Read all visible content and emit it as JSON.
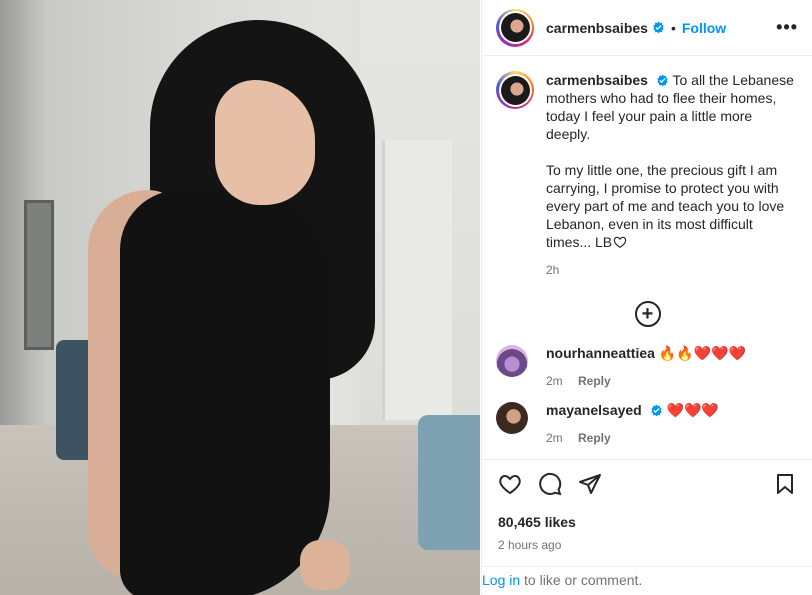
{
  "post": {
    "username": "carmenbsaibes",
    "follow_label": "Follow",
    "separator": "•",
    "more_label": "•••"
  },
  "caption": {
    "username": "carmenbsaibes",
    "para1": "To all the Lebanese mothers who had to flee their homes, today I feel your pain a little more deeply.",
    "para2": "To my little one, the precious gift I am carrying, I promise to protect you with every part of me and teach you to love Lebanon, even in its most difficult times... LB",
    "time": "2h"
  },
  "comments": [
    {
      "username": "nourhanneattiea",
      "text": "🔥🔥❤️❤️❤️",
      "time": "2m",
      "reply": "Reply"
    },
    {
      "username": "mayanelsayed",
      "text": "❤️❤️❤️",
      "time": "2m",
      "reply": "Reply"
    }
  ],
  "stats": {
    "likes": "80,465 likes",
    "ago": "2 hours ago"
  },
  "login": {
    "link": "Log in",
    "rest": " to like or comment."
  },
  "colors": {
    "accent": "#0095f6",
    "verified": "#0095f6",
    "muted": "#737373"
  }
}
